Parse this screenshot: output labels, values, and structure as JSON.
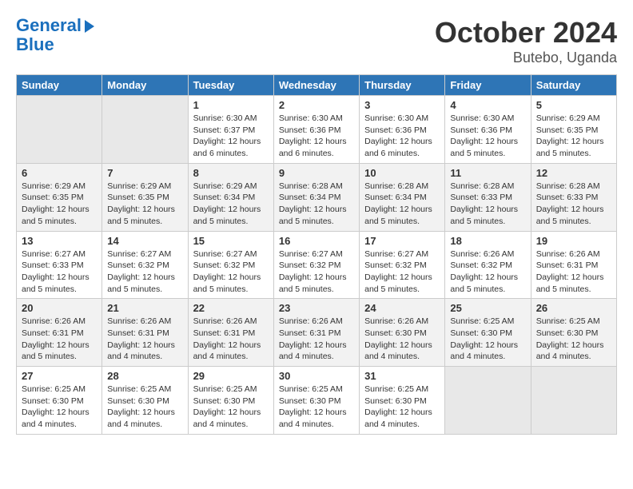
{
  "logo": {
    "line1": "General",
    "line2": "Blue"
  },
  "title": "October 2024",
  "location": "Butebo, Uganda",
  "weekdays": [
    "Sunday",
    "Monday",
    "Tuesday",
    "Wednesday",
    "Thursday",
    "Friday",
    "Saturday"
  ],
  "weeks": [
    [
      {
        "day": "",
        "empty": true
      },
      {
        "day": "",
        "empty": true
      },
      {
        "day": "1",
        "sunrise": "6:30 AM",
        "sunset": "6:37 PM",
        "daylight": "12 hours and 6 minutes."
      },
      {
        "day": "2",
        "sunrise": "6:30 AM",
        "sunset": "6:36 PM",
        "daylight": "12 hours and 6 minutes."
      },
      {
        "day": "3",
        "sunrise": "6:30 AM",
        "sunset": "6:36 PM",
        "daylight": "12 hours and 6 minutes."
      },
      {
        "day": "4",
        "sunrise": "6:30 AM",
        "sunset": "6:36 PM",
        "daylight": "12 hours and 5 minutes."
      },
      {
        "day": "5",
        "sunrise": "6:29 AM",
        "sunset": "6:35 PM",
        "daylight": "12 hours and 5 minutes."
      }
    ],
    [
      {
        "day": "6",
        "sunrise": "6:29 AM",
        "sunset": "6:35 PM",
        "daylight": "12 hours and 5 minutes."
      },
      {
        "day": "7",
        "sunrise": "6:29 AM",
        "sunset": "6:35 PM",
        "daylight": "12 hours and 5 minutes."
      },
      {
        "day": "8",
        "sunrise": "6:29 AM",
        "sunset": "6:34 PM",
        "daylight": "12 hours and 5 minutes."
      },
      {
        "day": "9",
        "sunrise": "6:28 AM",
        "sunset": "6:34 PM",
        "daylight": "12 hours and 5 minutes."
      },
      {
        "day": "10",
        "sunrise": "6:28 AM",
        "sunset": "6:34 PM",
        "daylight": "12 hours and 5 minutes."
      },
      {
        "day": "11",
        "sunrise": "6:28 AM",
        "sunset": "6:33 PM",
        "daylight": "12 hours and 5 minutes."
      },
      {
        "day": "12",
        "sunrise": "6:28 AM",
        "sunset": "6:33 PM",
        "daylight": "12 hours and 5 minutes."
      }
    ],
    [
      {
        "day": "13",
        "sunrise": "6:27 AM",
        "sunset": "6:33 PM",
        "daylight": "12 hours and 5 minutes."
      },
      {
        "day": "14",
        "sunrise": "6:27 AM",
        "sunset": "6:32 PM",
        "daylight": "12 hours and 5 minutes."
      },
      {
        "day": "15",
        "sunrise": "6:27 AM",
        "sunset": "6:32 PM",
        "daylight": "12 hours and 5 minutes."
      },
      {
        "day": "16",
        "sunrise": "6:27 AM",
        "sunset": "6:32 PM",
        "daylight": "12 hours and 5 minutes."
      },
      {
        "day": "17",
        "sunrise": "6:27 AM",
        "sunset": "6:32 PM",
        "daylight": "12 hours and 5 minutes."
      },
      {
        "day": "18",
        "sunrise": "6:26 AM",
        "sunset": "6:32 PM",
        "daylight": "12 hours and 5 minutes."
      },
      {
        "day": "19",
        "sunrise": "6:26 AM",
        "sunset": "6:31 PM",
        "daylight": "12 hours and 5 minutes."
      }
    ],
    [
      {
        "day": "20",
        "sunrise": "6:26 AM",
        "sunset": "6:31 PM",
        "daylight": "12 hours and 5 minutes."
      },
      {
        "day": "21",
        "sunrise": "6:26 AM",
        "sunset": "6:31 PM",
        "daylight": "12 hours and 4 minutes."
      },
      {
        "day": "22",
        "sunrise": "6:26 AM",
        "sunset": "6:31 PM",
        "daylight": "12 hours and 4 minutes."
      },
      {
        "day": "23",
        "sunrise": "6:26 AM",
        "sunset": "6:31 PM",
        "daylight": "12 hours and 4 minutes."
      },
      {
        "day": "24",
        "sunrise": "6:26 AM",
        "sunset": "6:30 PM",
        "daylight": "12 hours and 4 minutes."
      },
      {
        "day": "25",
        "sunrise": "6:25 AM",
        "sunset": "6:30 PM",
        "daylight": "12 hours and 4 minutes."
      },
      {
        "day": "26",
        "sunrise": "6:25 AM",
        "sunset": "6:30 PM",
        "daylight": "12 hours and 4 minutes."
      }
    ],
    [
      {
        "day": "27",
        "sunrise": "6:25 AM",
        "sunset": "6:30 PM",
        "daylight": "12 hours and 4 minutes."
      },
      {
        "day": "28",
        "sunrise": "6:25 AM",
        "sunset": "6:30 PM",
        "daylight": "12 hours and 4 minutes."
      },
      {
        "day": "29",
        "sunrise": "6:25 AM",
        "sunset": "6:30 PM",
        "daylight": "12 hours and 4 minutes."
      },
      {
        "day": "30",
        "sunrise": "6:25 AM",
        "sunset": "6:30 PM",
        "daylight": "12 hours and 4 minutes."
      },
      {
        "day": "31",
        "sunrise": "6:25 AM",
        "sunset": "6:30 PM",
        "daylight": "12 hours and 4 minutes."
      },
      {
        "day": "",
        "empty": true
      },
      {
        "day": "",
        "empty": true
      }
    ]
  ]
}
